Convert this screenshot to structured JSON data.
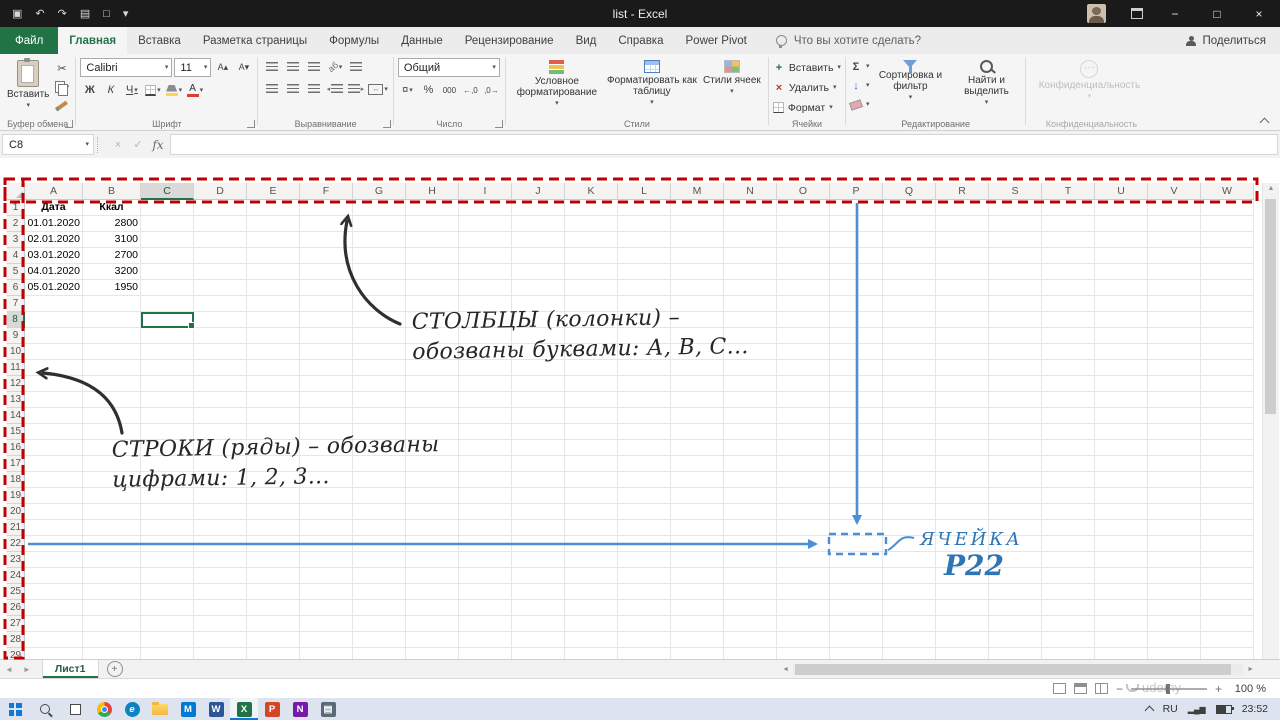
{
  "colors": {
    "excel_green": "#217346",
    "annotation_red": "#c00000",
    "annotation_blue": "#2e75b6",
    "arrow_blue": "#4a8ed5",
    "taskbar_accent": "#1079d8"
  },
  "icons": {
    "dropdown": "▾",
    "scissors": "✂",
    "grow_font": "А▴",
    "shrink_font": "А▾",
    "letter_A": "А",
    "currency": "¤",
    "percent": "%",
    "thousands": "000",
    "inc_decimal": "←,0",
    "dec_decimal": ",0→",
    "orientation": "аб",
    "merge_arrows": "↔",
    "indent_left": "◂",
    "indent_right": "▸",
    "sum": "Σ",
    "fill_down": "↓",
    "plus": "+",
    "cross": "×",
    "nav_left": "◄",
    "nav_right": "►",
    "scroll_up": "▲",
    "minimize": "−",
    "maximize": "□",
    "close": "×"
  },
  "titlebar": {
    "title": "list - Excel",
    "quick_access": [
      {
        "name": "save-icon",
        "glyph": "▣"
      },
      {
        "name": "undo-icon",
        "glyph": "↶"
      },
      {
        "name": "redo-icon",
        "glyph": "↷"
      },
      {
        "name": "open-icon",
        "glyph": "▤"
      },
      {
        "name": "new-icon",
        "glyph": "□"
      },
      {
        "name": "customize-quick-access-icon",
        "glyph": "▾"
      }
    ]
  },
  "ribbon": {
    "tabs": [
      {
        "id": "file",
        "label": "Файл"
      },
      {
        "id": "home",
        "label": "Главная",
        "active": true
      },
      {
        "id": "insert",
        "label": "Вставка"
      },
      {
        "id": "page-layout",
        "label": "Разметка страницы"
      },
      {
        "id": "formulas",
        "label": "Формулы"
      },
      {
        "id": "data",
        "label": "Данные"
      },
      {
        "id": "review",
        "label": "Рецензирование"
      },
      {
        "id": "view",
        "label": "Вид"
      },
      {
        "id": "help",
        "label": "Справка"
      },
      {
        "id": "power-pivot",
        "label": "Power Pivot"
      }
    ],
    "tell_me": "Что вы хотите сделать?",
    "share": "Поделиться",
    "clipboard": {
      "paste": "Вставить",
      "label": "Буфер обмена"
    },
    "font": {
      "family": "Calibri",
      "size": "11",
      "bold": "Ж",
      "italic": "К",
      "underline": "Ч",
      "label": "Шрифт"
    },
    "alignment": {
      "label": "Выравнивание"
    },
    "number": {
      "format": "Общий",
      "label": "Число"
    },
    "styles": {
      "conditional": "Условное форматирование",
      "table": "Форматировать как таблицу",
      "cellstyles": "Стили ячеек",
      "label": "Стили"
    },
    "cells": {
      "insert": "Вставить",
      "delete": "Удалить",
      "format": "Формат",
      "label": "Ячейки"
    },
    "editing": {
      "sort": "Сортировка и фильтр",
      "find": "Найти и выделить",
      "label": "Редактирование"
    },
    "privacy": {
      "button": "Конфиденциальность",
      "label": "Конфиденциальность"
    }
  },
  "formula_bar": {
    "name_box": "C8",
    "cancel": "×",
    "enter": "✓",
    "fx": "fx"
  },
  "sheet": {
    "columns": [
      "A",
      "B",
      "C",
      "D",
      "E",
      "F",
      "G",
      "H",
      "I",
      "J",
      "K",
      "L",
      "M",
      "N",
      "O",
      "P",
      "Q",
      "R",
      "S",
      "T",
      "U",
      "V",
      "W"
    ],
    "row_count": 29,
    "selected_cell": "C8",
    "cells": [
      {
        "ref": "A1",
        "value": "Дата",
        "bold": true,
        "align": "center"
      },
      {
        "ref": "B1",
        "value": "Ккал",
        "bold": true,
        "align": "center"
      },
      {
        "ref": "A2",
        "value": "01.01.2020",
        "align": "right"
      },
      {
        "ref": "B2",
        "value": "2800",
        "align": "right"
      },
      {
        "ref": "A3",
        "value": "02.01.2020",
        "align": "right"
      },
      {
        "ref": "B3",
        "value": "3100",
        "align": "right"
      },
      {
        "ref": "A4",
        "value": "03.01.2020",
        "align": "right"
      },
      {
        "ref": "B4",
        "value": "2700",
        "align": "right"
      },
      {
        "ref": "A5",
        "value": "04.01.2020",
        "align": "right"
      },
      {
        "ref": "B5",
        "value": "3200",
        "align": "right"
      },
      {
        "ref": "A6",
        "value": "05.01.2020",
        "align": "right"
      },
      {
        "ref": "B6",
        "value": "1950",
        "align": "right"
      }
    ]
  },
  "annotations": {
    "columns_note_1": "СТОЛБЦЫ (колонки) –",
    "columns_note_2": "обозваны буквами: А, В, С...",
    "rows_note_1": "СТРОКИ (ряды) – обозваны",
    "rows_note_2": "цифрами: 1, 2, 3...",
    "cell_label": "ЯЧЕЙКА",
    "cell_ref": "Р22"
  },
  "sheet_tabs": {
    "active": "Лист1"
  },
  "status_bar": {
    "zoom": "100 %"
  },
  "watermark": "udemy",
  "taskbar": {
    "tray_language": "RU",
    "time": "23:52",
    "apps": [
      {
        "name": "chrome",
        "kind": "chrome"
      },
      {
        "name": "edge",
        "kind": "round",
        "color": "#0a84c1",
        "letter": "e"
      },
      {
        "name": "file-explorer",
        "kind": "folder"
      },
      {
        "name": "mail",
        "kind": "square",
        "color": "#0078d4",
        "letter": "M"
      },
      {
        "name": "word",
        "kind": "square",
        "color": "#2b579a",
        "letter": "W"
      },
      {
        "name": "excel",
        "kind": "square",
        "color": "#217346",
        "letter": "X",
        "active": true
      },
      {
        "name": "powerpoint",
        "kind": "square",
        "color": "#d24726",
        "letter": "P"
      },
      {
        "name": "onenote",
        "kind": "square",
        "color": "#7719aa",
        "letter": "N"
      },
      {
        "name": "notepad",
        "kind": "square",
        "color": "#5a6a7a",
        "letter": "▤"
      }
    ]
  }
}
